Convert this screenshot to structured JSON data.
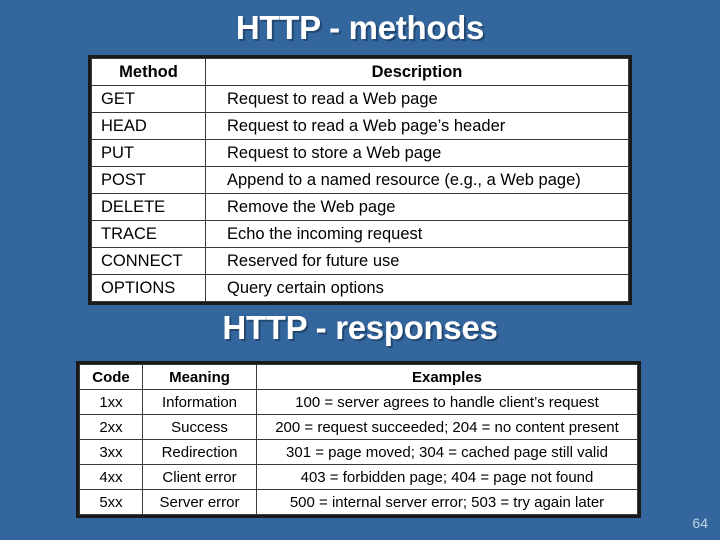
{
  "slide": {
    "background_color": "#33669D",
    "page_number": "64"
  },
  "titles": {
    "methods": "HTTP - methods",
    "responses": "HTTP - responses"
  },
  "methods_table": {
    "headers": [
      "Method",
      "Description"
    ],
    "rows": [
      [
        "GET",
        "Request to read a Web page"
      ],
      [
        "HEAD",
        "Request to read a Web page’s header"
      ],
      [
        "PUT",
        "Request to store a Web page"
      ],
      [
        "POST",
        "Append to a named resource (e.g., a Web page)"
      ],
      [
        "DELETE",
        "Remove the Web page"
      ],
      [
        "TRACE",
        "Echo the incoming request"
      ],
      [
        "CONNECT",
        "Reserved for future use"
      ],
      [
        "OPTIONS",
        "Query certain options"
      ]
    ]
  },
  "responses_table": {
    "headers": [
      "Code",
      "Meaning",
      "Examples"
    ],
    "rows": [
      [
        "1xx",
        "Information",
        "100 = server agrees to handle client’s request"
      ],
      [
        "2xx",
        "Success",
        "200 = request succeeded; 204 = no content present"
      ],
      [
        "3xx",
        "Redirection",
        "301 = page moved; 304 = cached page still valid"
      ],
      [
        "4xx",
        "Client error",
        "403 = forbidden page; 404 = page not found"
      ],
      [
        "5xx",
        "Server error",
        "500 = internal server error; 503 = try again later"
      ]
    ]
  }
}
